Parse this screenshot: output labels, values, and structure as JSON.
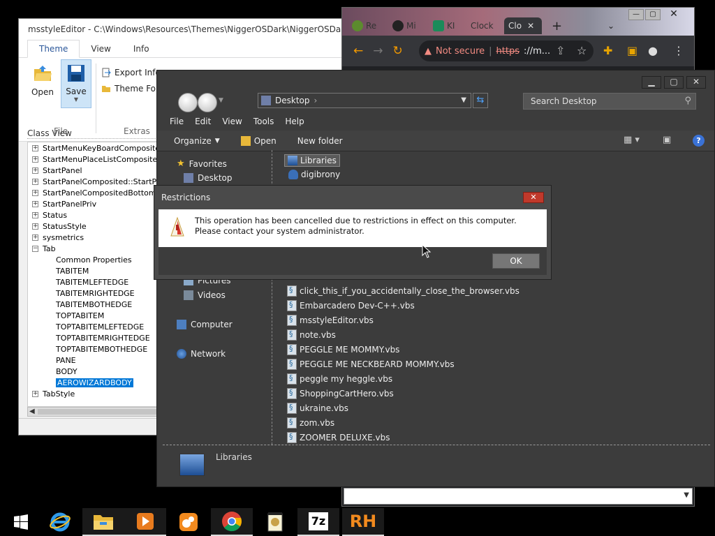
{
  "mse": {
    "title": "msstyleEditor - C:\\Windows\\Resources\\Themes\\NiggerOSDark\\NiggerOSDark.msstyles",
    "tabs": [
      "Theme",
      "View",
      "Info"
    ],
    "buttons": {
      "open": "Open",
      "save": "Save",
      "export_info": "Export Info",
      "theme_folder": "Theme Folder"
    },
    "groups": {
      "file": "File",
      "extras": "Extras"
    },
    "class_view_label": "Class View",
    "tree": [
      {
        "label": "StartMenuKeyBoardComposited::Toolbar",
        "level": 0
      },
      {
        "label": "StartMenuPlaceListComposited::ListView",
        "level": 0
      },
      {
        "label": "StartPanel",
        "level": 0
      },
      {
        "label": "StartPanelComposited::StartPanelPriv",
        "level": 0
      },
      {
        "label": "StartPanelCompositedBottom::StartPanelPriv",
        "level": 0
      },
      {
        "label": "StartPanelPriv",
        "level": 0
      },
      {
        "label": "Status",
        "level": 0
      },
      {
        "label": "StatusStyle",
        "level": 0
      },
      {
        "label": "sysmetrics",
        "level": 0
      },
      {
        "label": "Tab",
        "level": 0,
        "expanded": true
      },
      {
        "label": "Common Properties",
        "level": 1
      },
      {
        "label": "TABITEM",
        "level": 1
      },
      {
        "label": "TABITEMLEFTEDGE",
        "level": 1
      },
      {
        "label": "TABITEMRIGHTEDGE",
        "level": 1
      },
      {
        "label": "TABITEMBOTHEDGE",
        "level": 1
      },
      {
        "label": "TOPTABITEM",
        "level": 1
      },
      {
        "label": "TOPTABITEMLEFTEDGE",
        "level": 1
      },
      {
        "label": "TOPTABITEMRIGHTEDGE",
        "level": 1
      },
      {
        "label": "TOPTABITEMBOTHEDGE",
        "level": 1
      },
      {
        "label": "PANE",
        "level": 1
      },
      {
        "label": "BODY",
        "level": 1
      },
      {
        "label": "AEROWIZARDBODY",
        "level": 1,
        "selected": true
      },
      {
        "label": "TabStyle",
        "level": 0
      }
    ]
  },
  "chrome": {
    "tabs": [
      "Re",
      "Mi",
      "KI",
      "Clock",
      "Clo"
    ],
    "address": {
      "warning_label": "Not secure",
      "scheme": "https",
      "rest": "://m..."
    }
  },
  "explorer": {
    "address_text": "Desktop",
    "search_placeholder": "Search Desktop",
    "menu": [
      "File",
      "Edit",
      "View",
      "Tools",
      "Help"
    ],
    "commands": {
      "organize": "Organize",
      "open": "Open",
      "new_folder": "New folder"
    },
    "nav": {
      "favorites": "Favorites",
      "desktop": "Desktop",
      "pictures": "Pictures",
      "videos": "Videos",
      "computer": "Computer",
      "network": "Network"
    },
    "files_top": [
      {
        "name": "Libraries",
        "selected": true
      },
      {
        "name": "digibrony"
      }
    ],
    "files": [
      "click_this_if_you_accidentally_close_the_browser.vbs",
      "Embarcadero Dev-C++.vbs",
      "msstyleEditor.vbs",
      "note.vbs",
      "PEGGLE ME MOMMY.vbs",
      "PEGGLE ME NECKBEARD MOMMY.vbs",
      "peggle my heggle.vbs",
      "ShoppingCartHero.vbs",
      "ukraine.vbs",
      "zom.vbs",
      "ZOOMER DELUXE.vbs"
    ],
    "details_label": "Libraries"
  },
  "dialog": {
    "title": "Restrictions",
    "message": "This operation has been cancelled due to restrictions in effect on this computer. Please contact your system administrator.",
    "ok": "OK"
  },
  "taskbar": {
    "items": [
      "start-icon",
      "internet-explorer-icon",
      "file-explorer-icon",
      "media-player-icon",
      "uc-browser-icon",
      "chrome-icon",
      "notepad-icon",
      "7zip-icon",
      "resource-hacker-icon"
    ],
    "seven_zip_label": "7z",
    "rh_label": "RH"
  }
}
